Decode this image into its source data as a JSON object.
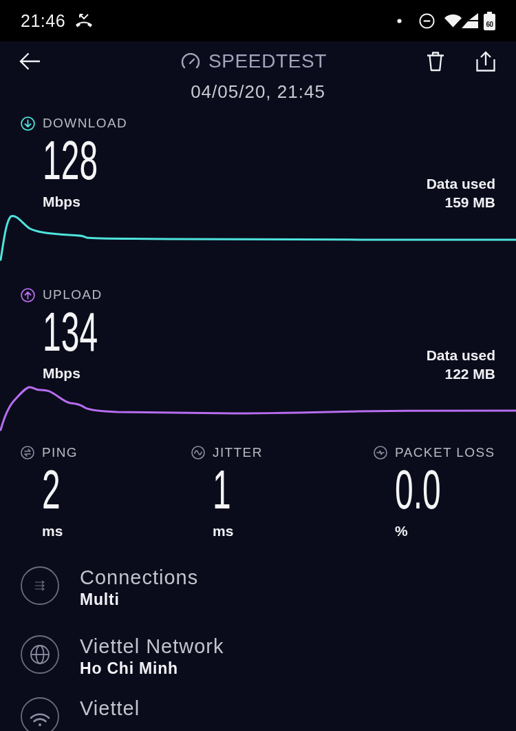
{
  "status_bar": {
    "time": "21:46",
    "battery_text": "60"
  },
  "header": {
    "title": "SPEEDTEST",
    "date": "04/05/20, 21:45"
  },
  "results": [
    {
      "kind": "download",
      "label": "DOWNLOAD",
      "color": "#4ee4dd",
      "value": "128",
      "unit": "Mbps",
      "data_used_label": "Data used",
      "data_used": "159 MB"
    },
    {
      "kind": "upload",
      "label": "UPLOAD",
      "color": "#b76df0",
      "value": "134",
      "unit": "Mbps",
      "data_used_label": "Data used",
      "data_used": "122 MB"
    }
  ],
  "metrics": [
    {
      "kind": "ping",
      "label": "PING",
      "value": "2",
      "unit": "ms"
    },
    {
      "kind": "jitter",
      "label": "JITTER",
      "value": "1",
      "unit": "ms"
    },
    {
      "kind": "packet_loss",
      "label": "PACKET LOSS",
      "value": "0.0",
      "unit": "%"
    }
  ],
  "details": [
    {
      "kind": "connections",
      "title": "Connections",
      "subtitle": "Multi"
    },
    {
      "kind": "network",
      "title": "Viettel Network",
      "subtitle": "Ho Chi Minh"
    },
    {
      "kind": "wifi",
      "title": "Viettel"
    }
  ]
}
